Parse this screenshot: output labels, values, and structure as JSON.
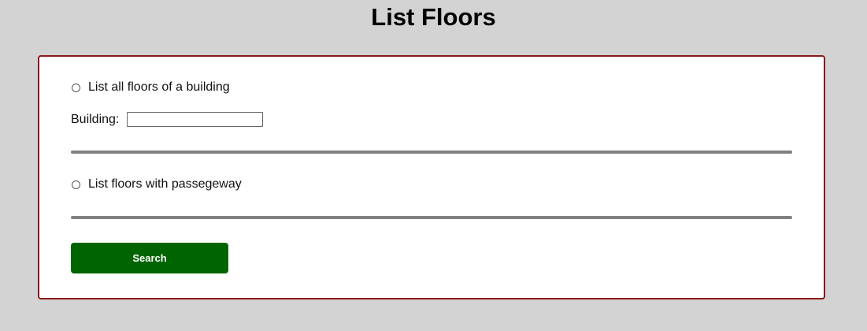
{
  "page": {
    "title": "List Floors"
  },
  "form": {
    "option_all_floors_label": "List all floors of a building",
    "building_label": "Building:",
    "building_value": "",
    "option_passageway_label": "List floors with passegeway",
    "search_label": "Search"
  },
  "colors": {
    "background": "#d3d3d3",
    "card_border": "#8b1a1a",
    "divider": "#808080",
    "search_button": "#006400"
  }
}
